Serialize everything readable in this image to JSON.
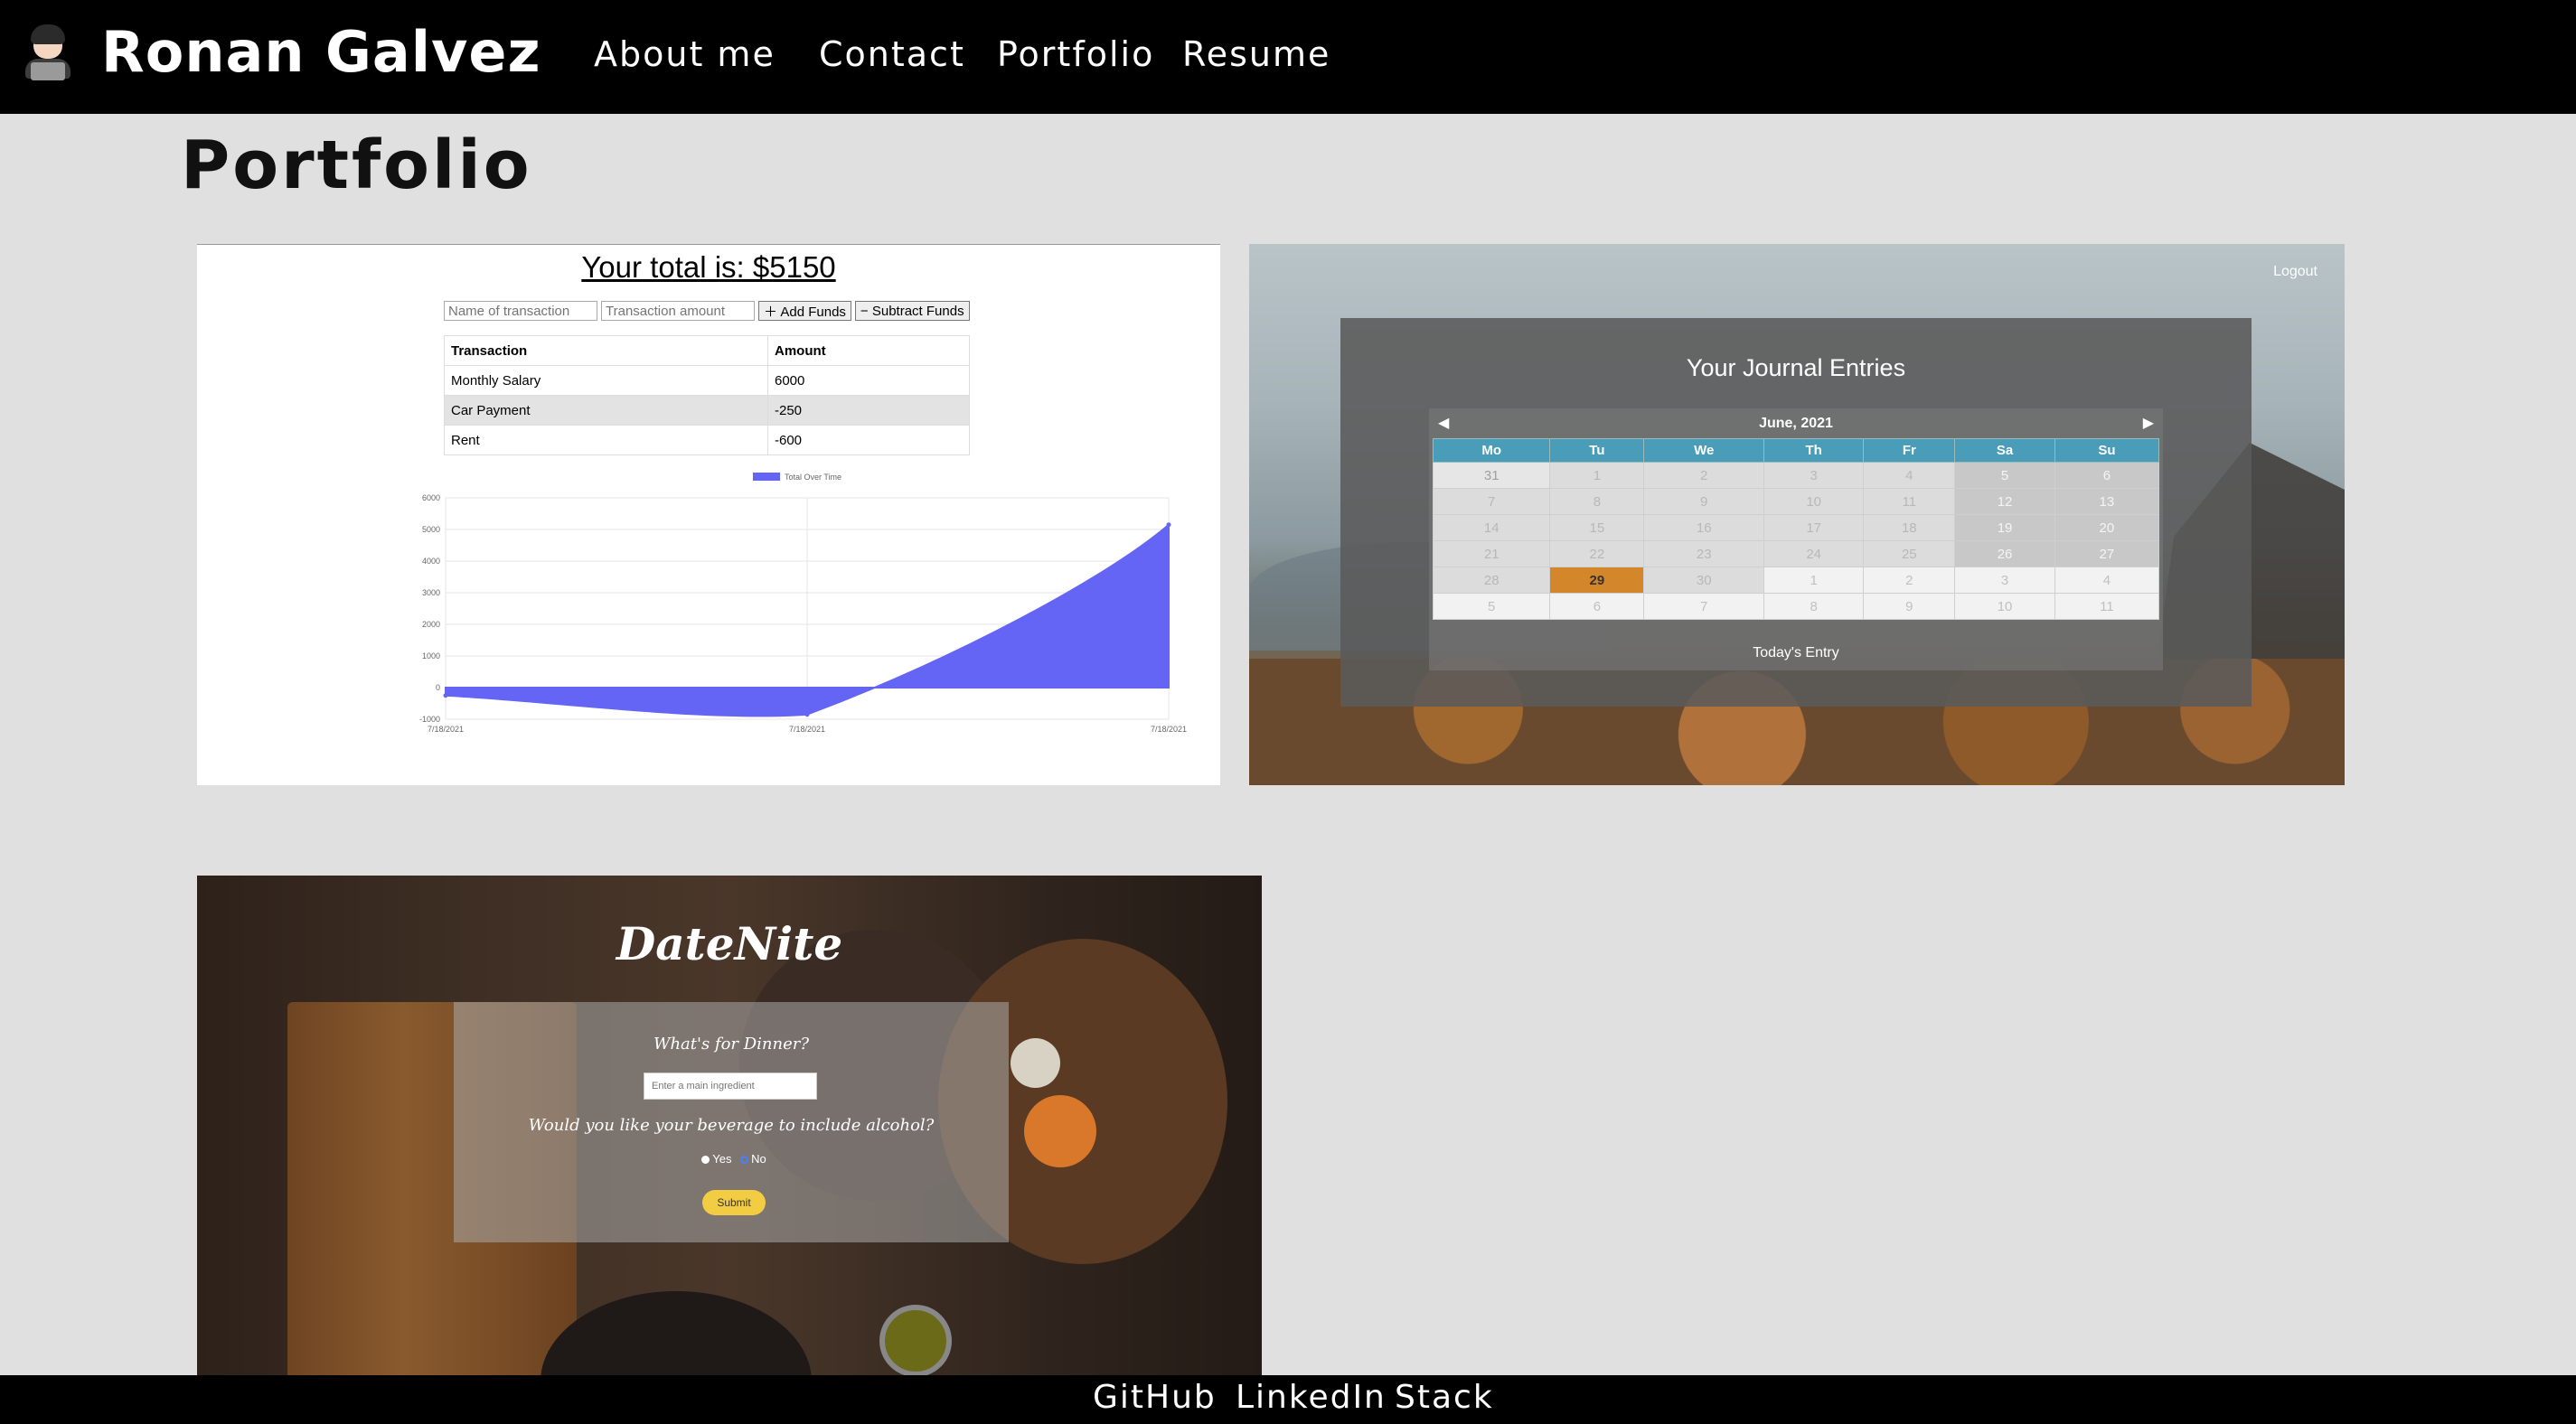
{
  "header": {
    "avatar_icon": "technologist-emoji-icon",
    "name": "Ronan Galvez",
    "nav": [
      {
        "label": "About me"
      },
      {
        "label": "Contact"
      },
      {
        "label": "Portfolio"
      },
      {
        "label": "Resume"
      }
    ]
  },
  "main": {
    "title": "Portfolio"
  },
  "projects": {
    "budget": {
      "total": "Your total is: $5150",
      "name_placeholder": "Name of transaction",
      "amount_placeholder": "Transaction amount",
      "add_label": "Add Funds",
      "subtract_label": "Subtract Funds",
      "headers": [
        "Transaction",
        "Amount"
      ],
      "rows": [
        [
          "Monthly Salary",
          "6000"
        ],
        [
          "Car Payment",
          "-250"
        ],
        [
          "Rent",
          "-600"
        ]
      ],
      "chart_data": {
        "type": "area",
        "series": [
          {
            "name": "Total Over Time",
            "values": [
              -250,
              -850,
              5150
            ]
          }
        ],
        "x": [
          "7/18/2021",
          "7/18/2021",
          "7/18/2021"
        ],
        "yticks": [
          "6000",
          "5000",
          "4000",
          "3000",
          "2000",
          "1000",
          "0",
          "-1000"
        ],
        "ylim": [
          -1000,
          6000
        ],
        "color": "#6464f5"
      }
    },
    "journal": {
      "logout": "Logout",
      "title": "Your Journal Entries",
      "month": "June, 2021",
      "days": [
        "Mo",
        "Tu",
        "We",
        "Th",
        "Fr",
        "Sa",
        "Su"
      ],
      "weeks": [
        [
          "31",
          "1",
          "2",
          "3",
          "4",
          "5",
          "6"
        ],
        [
          "7",
          "8",
          "9",
          "10",
          "11",
          "12",
          "13"
        ],
        [
          "14",
          "15",
          "16",
          "17",
          "18",
          "19",
          "20"
        ],
        [
          "21",
          "22",
          "23",
          "24",
          "25",
          "26",
          "27"
        ],
        [
          "28",
          "29",
          "30",
          "1",
          "2",
          "3",
          "4"
        ],
        [
          "5",
          "6",
          "7",
          "8",
          "9",
          "10",
          "11"
        ]
      ],
      "today": "29",
      "entry_label": "Today's Entry"
    },
    "datenite": {
      "logo": "DateNite",
      "question1": "What's for Dinner?",
      "ingredient_placeholder": "Enter a main ingredient",
      "question2": "Would you like your beverage to include alcohol?",
      "yes": "Yes",
      "no": "No",
      "submit": "Submit"
    }
  },
  "footer": {
    "links": [
      {
        "label": "GitHub"
      },
      {
        "label": "LinkedIn"
      },
      {
        "label": "Stack"
      }
    ]
  }
}
